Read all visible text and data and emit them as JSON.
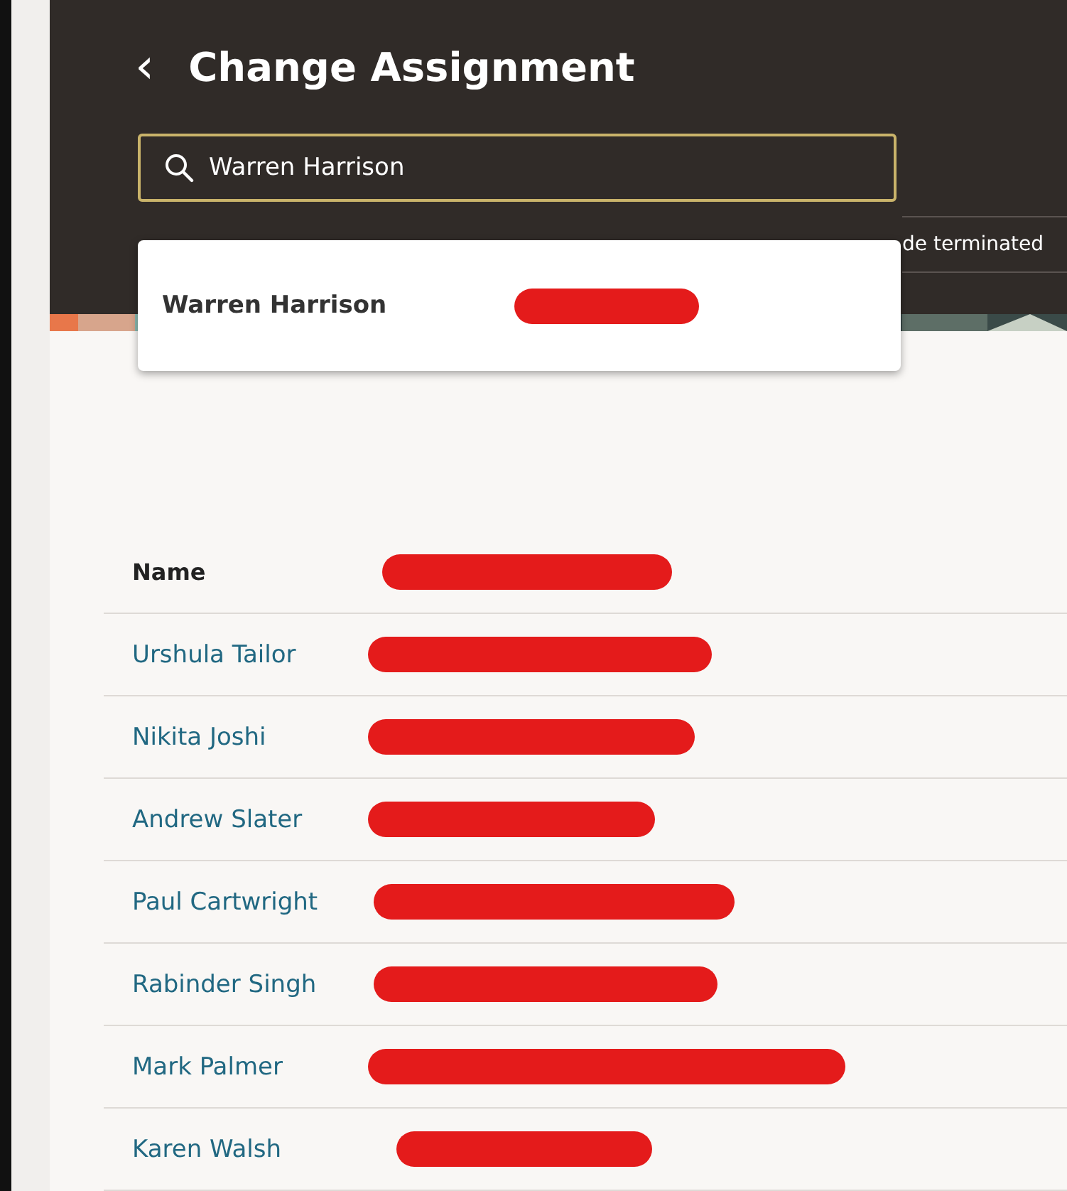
{
  "header": {
    "back_icon": "‹",
    "title": "Change Assignment"
  },
  "search": {
    "value": "Warren Harrison",
    "option_label": "de terminated"
  },
  "dropdown": {
    "items": [
      {
        "name": "Warren Harrison",
        "redacted": true
      }
    ]
  },
  "table": {
    "columns": [
      {
        "label": "Name",
        "redacted": true
      }
    ],
    "rows": [
      {
        "name": "Urshula Tailor",
        "redacted": true
      },
      {
        "name": "Nikita Joshi",
        "redacted": true
      },
      {
        "name": "Andrew Slater",
        "redacted": true
      },
      {
        "name": "Paul Cartwright",
        "redacted": true
      },
      {
        "name": "Rabinder Singh",
        "redacted": true
      },
      {
        "name": "Mark Palmer",
        "redacted": true
      },
      {
        "name": "Karen Walsh",
        "redacted": true
      }
    ]
  }
}
